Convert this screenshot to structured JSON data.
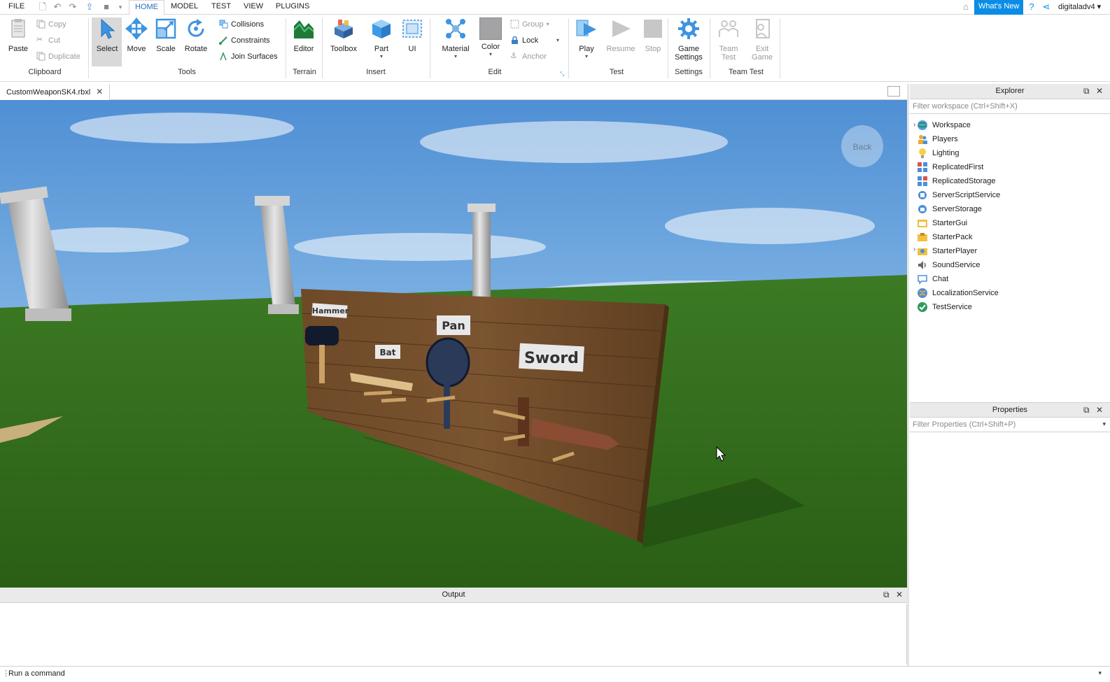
{
  "menubar": {
    "file": "FILE",
    "tabs": [
      "HOME",
      "MODEL",
      "TEST",
      "VIEW",
      "PLUGINS"
    ],
    "whats_new": "What's New",
    "username": "digitaladv4"
  },
  "ribbon": {
    "clipboard": {
      "paste": "Paste",
      "copy": "Copy",
      "cut": "Cut",
      "duplicate": "Duplicate",
      "label": "Clipboard"
    },
    "tools": {
      "select": "Select",
      "move": "Move",
      "scale": "Scale",
      "rotate": "Rotate",
      "collisions": "Collisions",
      "constraints": "Constraints",
      "join": "Join Surfaces",
      "label": "Tools"
    },
    "terrain": {
      "editor": "Editor",
      "label": "Terrain"
    },
    "insert": {
      "toolbox": "Toolbox",
      "part": "Part",
      "ui": "UI",
      "label": "Insert"
    },
    "edit": {
      "material": "Material",
      "color": "Color",
      "group": "Group",
      "lock": "Lock",
      "anchor": "Anchor",
      "label": "Edit"
    },
    "test": {
      "play": "Play",
      "resume": "Resume",
      "stop": "Stop",
      "label": "Test"
    },
    "settings": {
      "game_settings_1": "Game",
      "game_settings_2": "Settings",
      "label": "Settings"
    },
    "teamtest": {
      "team_test_1": "Team",
      "team_test_2": "Test",
      "exit_1": "Exit",
      "exit_2": "Game",
      "label": "Team Test"
    }
  },
  "document_tab": "CustomWeaponSK4.rbxl",
  "viewport": {
    "back_label": "Back",
    "signs": {
      "hammer": "Hammer",
      "bat": "Bat",
      "pan": "Pan",
      "sword": "Sword"
    }
  },
  "explorer": {
    "title": "Explorer",
    "filter_placeholder": "Filter workspace (Ctrl+Shift+X)",
    "items": [
      "Workspace",
      "Players",
      "Lighting",
      "ReplicatedFirst",
      "ReplicatedStorage",
      "ServerScriptService",
      "ServerStorage",
      "StarterGui",
      "StarterPack",
      "StarterPlayer",
      "SoundService",
      "Chat",
      "LocalizationService",
      "TestService"
    ]
  },
  "properties": {
    "title": "Properties",
    "filter_placeholder": "Filter Properties (Ctrl+Shift+P)"
  },
  "output": {
    "title": "Output"
  },
  "command_bar": {
    "placeholder": "Run a command"
  }
}
